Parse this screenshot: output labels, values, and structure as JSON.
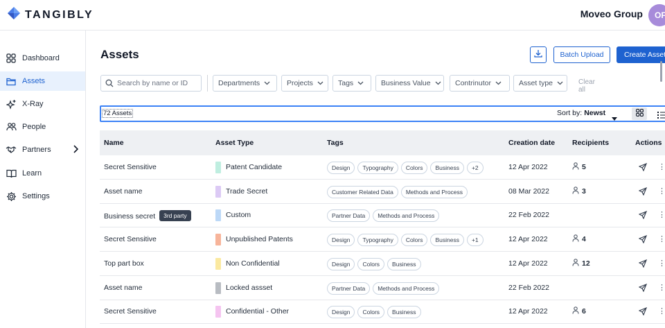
{
  "app": {
    "brand": "TANGIBLY",
    "org_name": "Moveo Group",
    "avatar_initials": "OF",
    "accent": "#1e62d0"
  },
  "sidebar": {
    "items": [
      {
        "label": "Dashboard",
        "icon": "dashboard-grid-icon"
      },
      {
        "label": "Assets",
        "icon": "folder-icon",
        "active": true
      },
      {
        "label": "X-Ray",
        "icon": "sparkle-icon"
      },
      {
        "label": "People",
        "icon": "people-icon"
      },
      {
        "label": "Partners",
        "icon": "handshake-icon"
      },
      {
        "label": "Learn",
        "icon": "book-icon"
      },
      {
        "label": "Settings",
        "icon": "gear-icon"
      }
    ]
  },
  "header": {
    "title": "Assets",
    "batch_upload_label": "Batch Upload",
    "create_asset_label": "Create Asset"
  },
  "filters": {
    "search_placeholder": "Search by name or ID",
    "dropdowns": [
      "Departments",
      "Projects",
      "Tags",
      "Business Value",
      "Contrinutor",
      "Asset type"
    ],
    "clear_label": "Clear all"
  },
  "list_bar": {
    "count_label": "72 Assets",
    "sort_prefix": "Sort by:",
    "sort_value": "Newst"
  },
  "table": {
    "columns": [
      "Name",
      "Asset Type",
      "Tags",
      "Creation date",
      "Recipients",
      "Actions"
    ],
    "rows": [
      {
        "name": "Secret Sensitive",
        "type": "Patent Candidate",
        "color": "#bfeee0",
        "tags": [
          "Design",
          "Typography",
          "Colors",
          "Business",
          "+2"
        ],
        "date": "12 Apr 2022",
        "recipients": "5"
      },
      {
        "name": "Asset name",
        "type": "Trade Secret",
        "color": "#dccaf5",
        "tags": [
          "Customer Related Data",
          "Methods and Process"
        ],
        "date": "08 Mar 2022",
        "recipients": "3"
      },
      {
        "name": "Business secret",
        "badge": "3rd party",
        "type": "Custom",
        "color": "#bcd8f7",
        "tags": [
          "Partner Data",
          "Methods and Process"
        ],
        "date": "22 Feb 2022",
        "recipients": ""
      },
      {
        "name": "Secret Sensitive",
        "type": "Unpublished Patents",
        "color": "#f7b49a",
        "tags": [
          "Design",
          "Typography",
          "Colors",
          "Business",
          "+1"
        ],
        "date": "12 Apr 2022",
        "recipients": "4"
      },
      {
        "name": "Top part box",
        "type": "Non Confidential",
        "color": "#fbe9a0",
        "tags": [
          "Design",
          "Colors",
          "Business"
        ],
        "date": "12 Apr 2022",
        "recipients": "12"
      },
      {
        "name": "Asset name",
        "type": "Locked assset",
        "color": "#b8bcc2",
        "tags": [
          "Partner Data",
          "Methods and Process"
        ],
        "date": "22 Feb 2022",
        "recipients": ""
      },
      {
        "name": "Secret Sensitive",
        "type": "Confidential - Other",
        "color": "#f5c4f0",
        "tags": [
          "Design",
          "Colors",
          "Business"
        ],
        "date": "12 Apr 2022",
        "recipients": "6"
      }
    ]
  }
}
